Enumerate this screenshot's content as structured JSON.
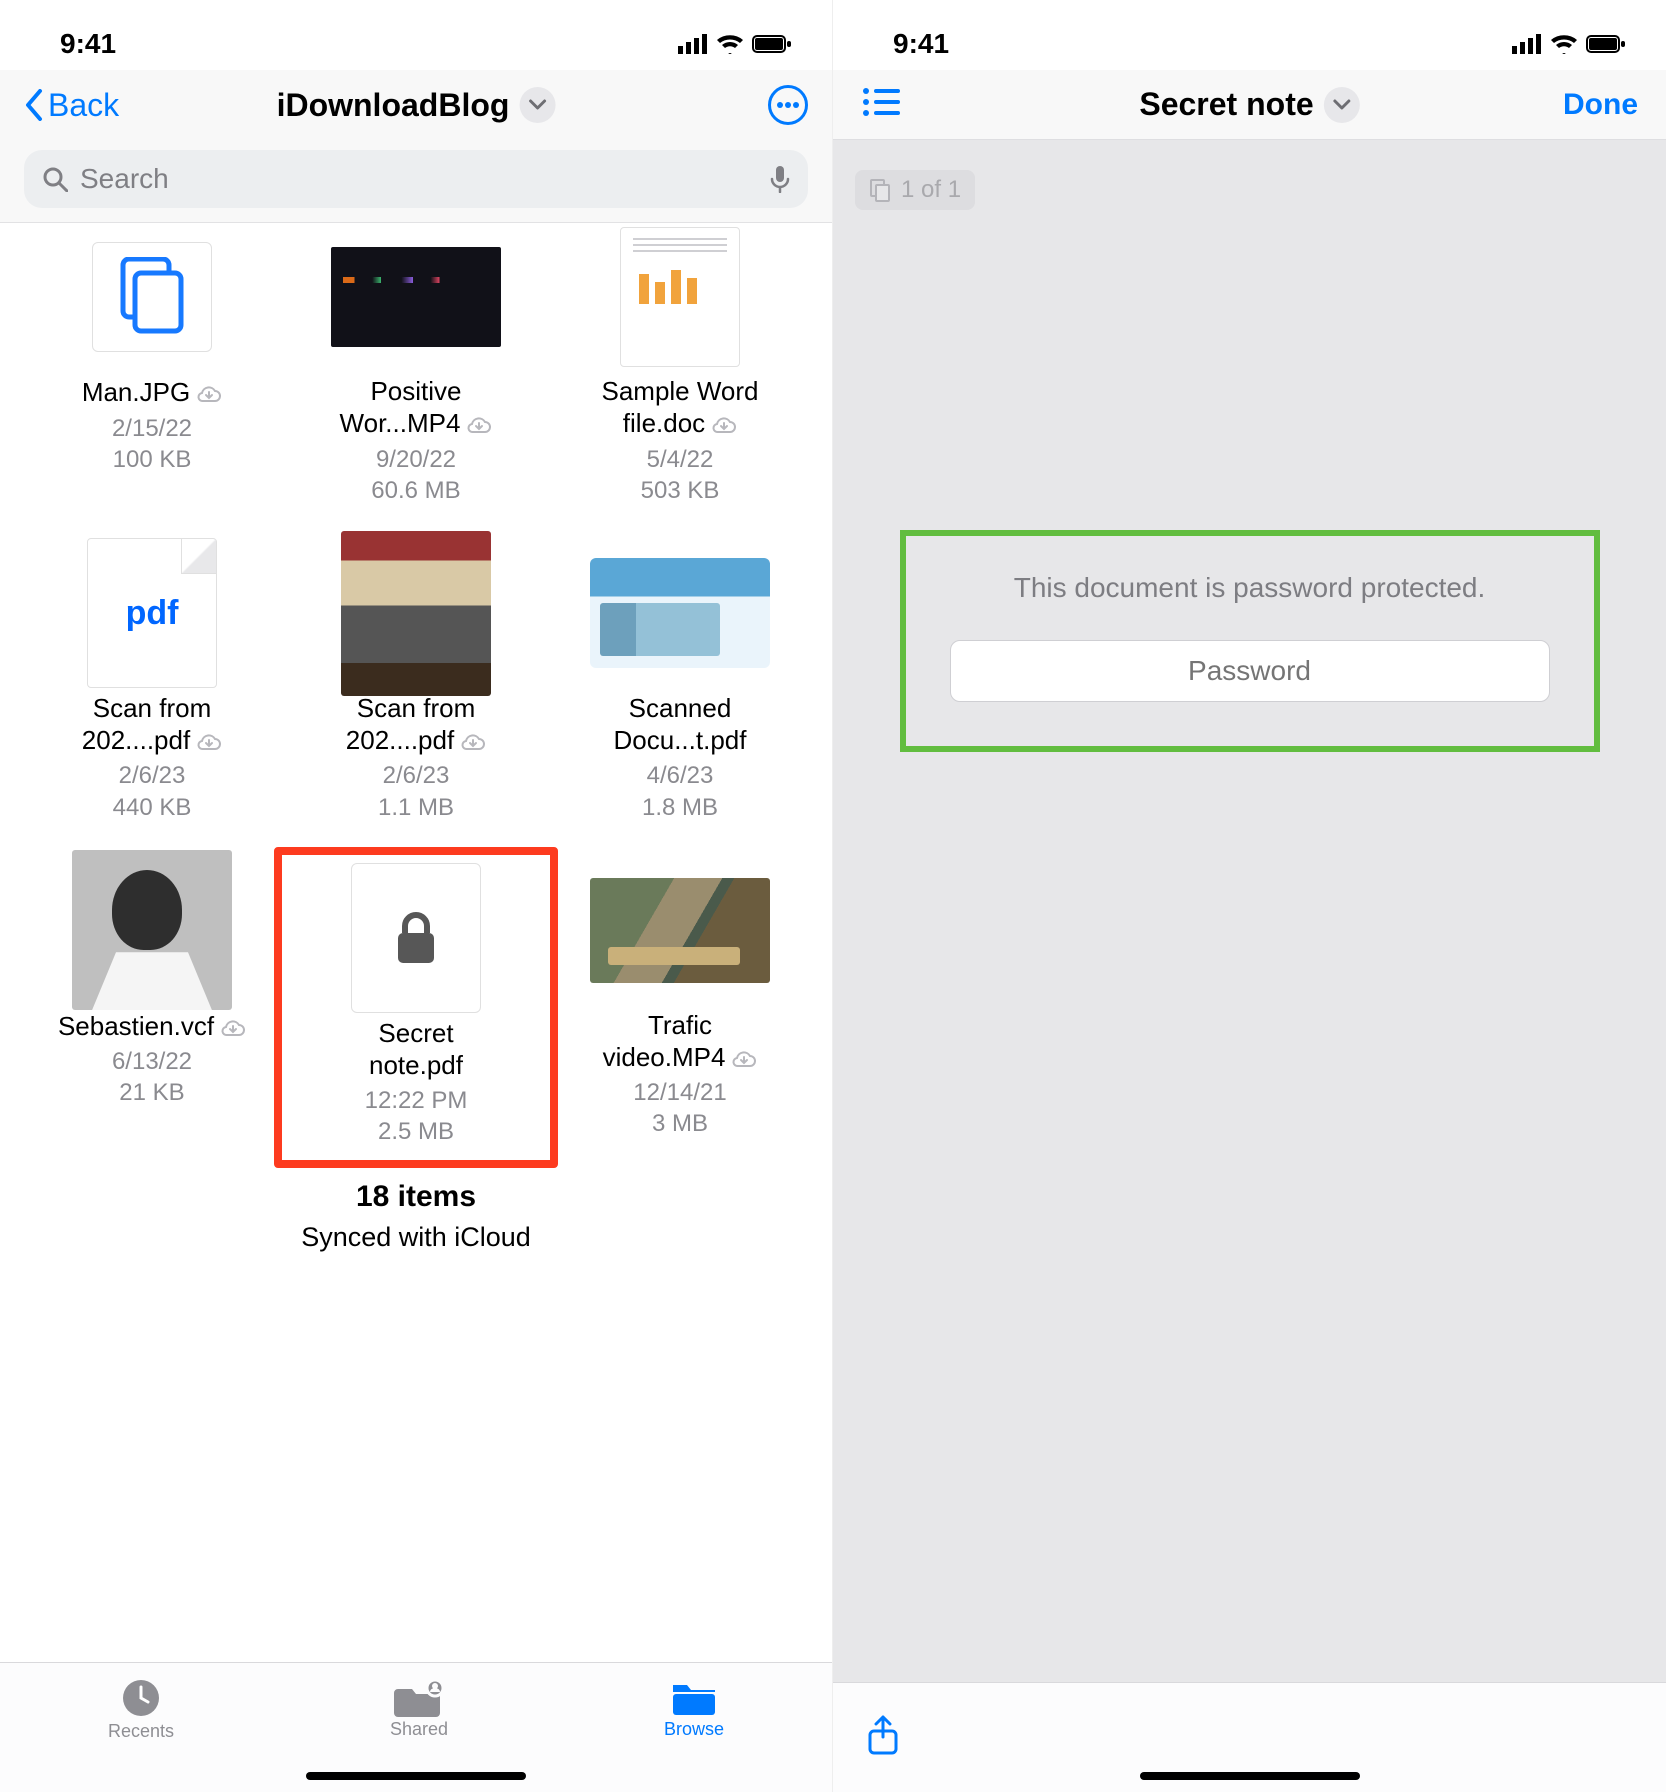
{
  "status": {
    "time": "9:41"
  },
  "left": {
    "back": "Back",
    "title": "iDownloadBlog",
    "searchPlaceholder": "Search",
    "items": [
      {
        "name": "Man.JPG",
        "date": "2/15/22",
        "size": "100 KB",
        "cloud": true
      },
      {
        "name1": "Positive",
        "name2": "Wor...MP4",
        "date": "9/20/22",
        "size": "60.6 MB",
        "cloud": true
      },
      {
        "name1": "Sample Word",
        "name2": "file.doc",
        "date": "5/4/22",
        "size": "503 KB",
        "cloud": true
      },
      {
        "name1": "Scan from",
        "name2": "202....pdf",
        "date": "2/6/23",
        "size": "440 KB",
        "cloud": true
      },
      {
        "name1": "Scan from",
        "name2": "202....pdf",
        "date": "2/6/23",
        "size": "1.1 MB",
        "cloud": true
      },
      {
        "name1": "Scanned",
        "name2": "Docu...t.pdf",
        "date": "4/6/23",
        "size": "1.8 MB",
        "cloud": false
      },
      {
        "name1": "Sebastien.vcf",
        "date": "6/13/22",
        "size": "21 KB",
        "cloud": true
      },
      {
        "name1": "Secret",
        "name2": "note.pdf",
        "date": "12:22 PM",
        "size": "2.5 MB",
        "cloud": false
      },
      {
        "name1": "Trafic",
        "name2": "video.MP4",
        "date": "12/14/21",
        "size": "3 MB",
        "cloud": true
      }
    ],
    "footer": {
      "count": "18 items",
      "sync": "Synced with iCloud"
    },
    "tabs": {
      "recents": "Recents",
      "shared": "Shared",
      "browse": "Browse"
    }
  },
  "right": {
    "title": "Secret note",
    "done": "Done",
    "pageLabel": "1 of 1",
    "pwMessage": "This document is password protected.",
    "pwPlaceholder": "Password"
  }
}
